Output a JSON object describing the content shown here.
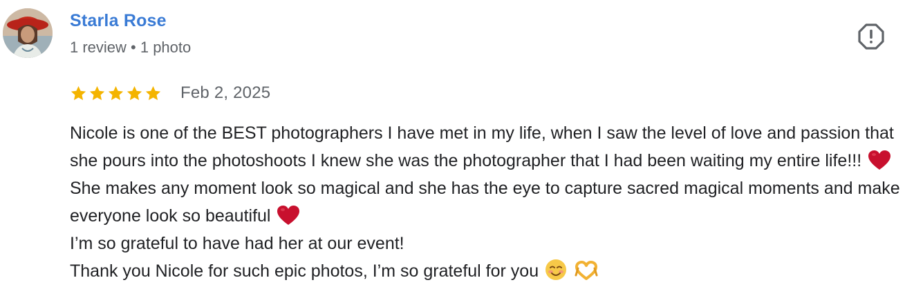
{
  "author": {
    "name": "Starla Rose",
    "meta": "1 review • 1 photo"
  },
  "review": {
    "rating": 5,
    "rating_max": 5,
    "date": "Feb 2, 2025",
    "text": {
      "segment_1": "Nicole is one of the BEST photographers I have met in my life, when I saw the level of love and passion that she pours into the photoshoots I knew she was the photographer that I had been waiting my entire life!!!",
      "segment_2": "She makes any moment look so magical and she has the eye to capture sacred magical moments and make everyone look so beautiful",
      "line_2": "I’m so grateful to have had her at our event!",
      "line_3": "Thank you Nicole for such epic photos, I’m so grateful for you"
    },
    "emojis": [
      "red-heart",
      "red-heart",
      "smiling-face",
      "heart-hands"
    ]
  },
  "colors": {
    "author_name": "#3a7bd5",
    "meta": "#5f6368",
    "star": "#f4b400",
    "text": "#202124",
    "heart": "#c8102e"
  },
  "icons": {
    "report": "report-icon",
    "star": "star-icon"
  }
}
